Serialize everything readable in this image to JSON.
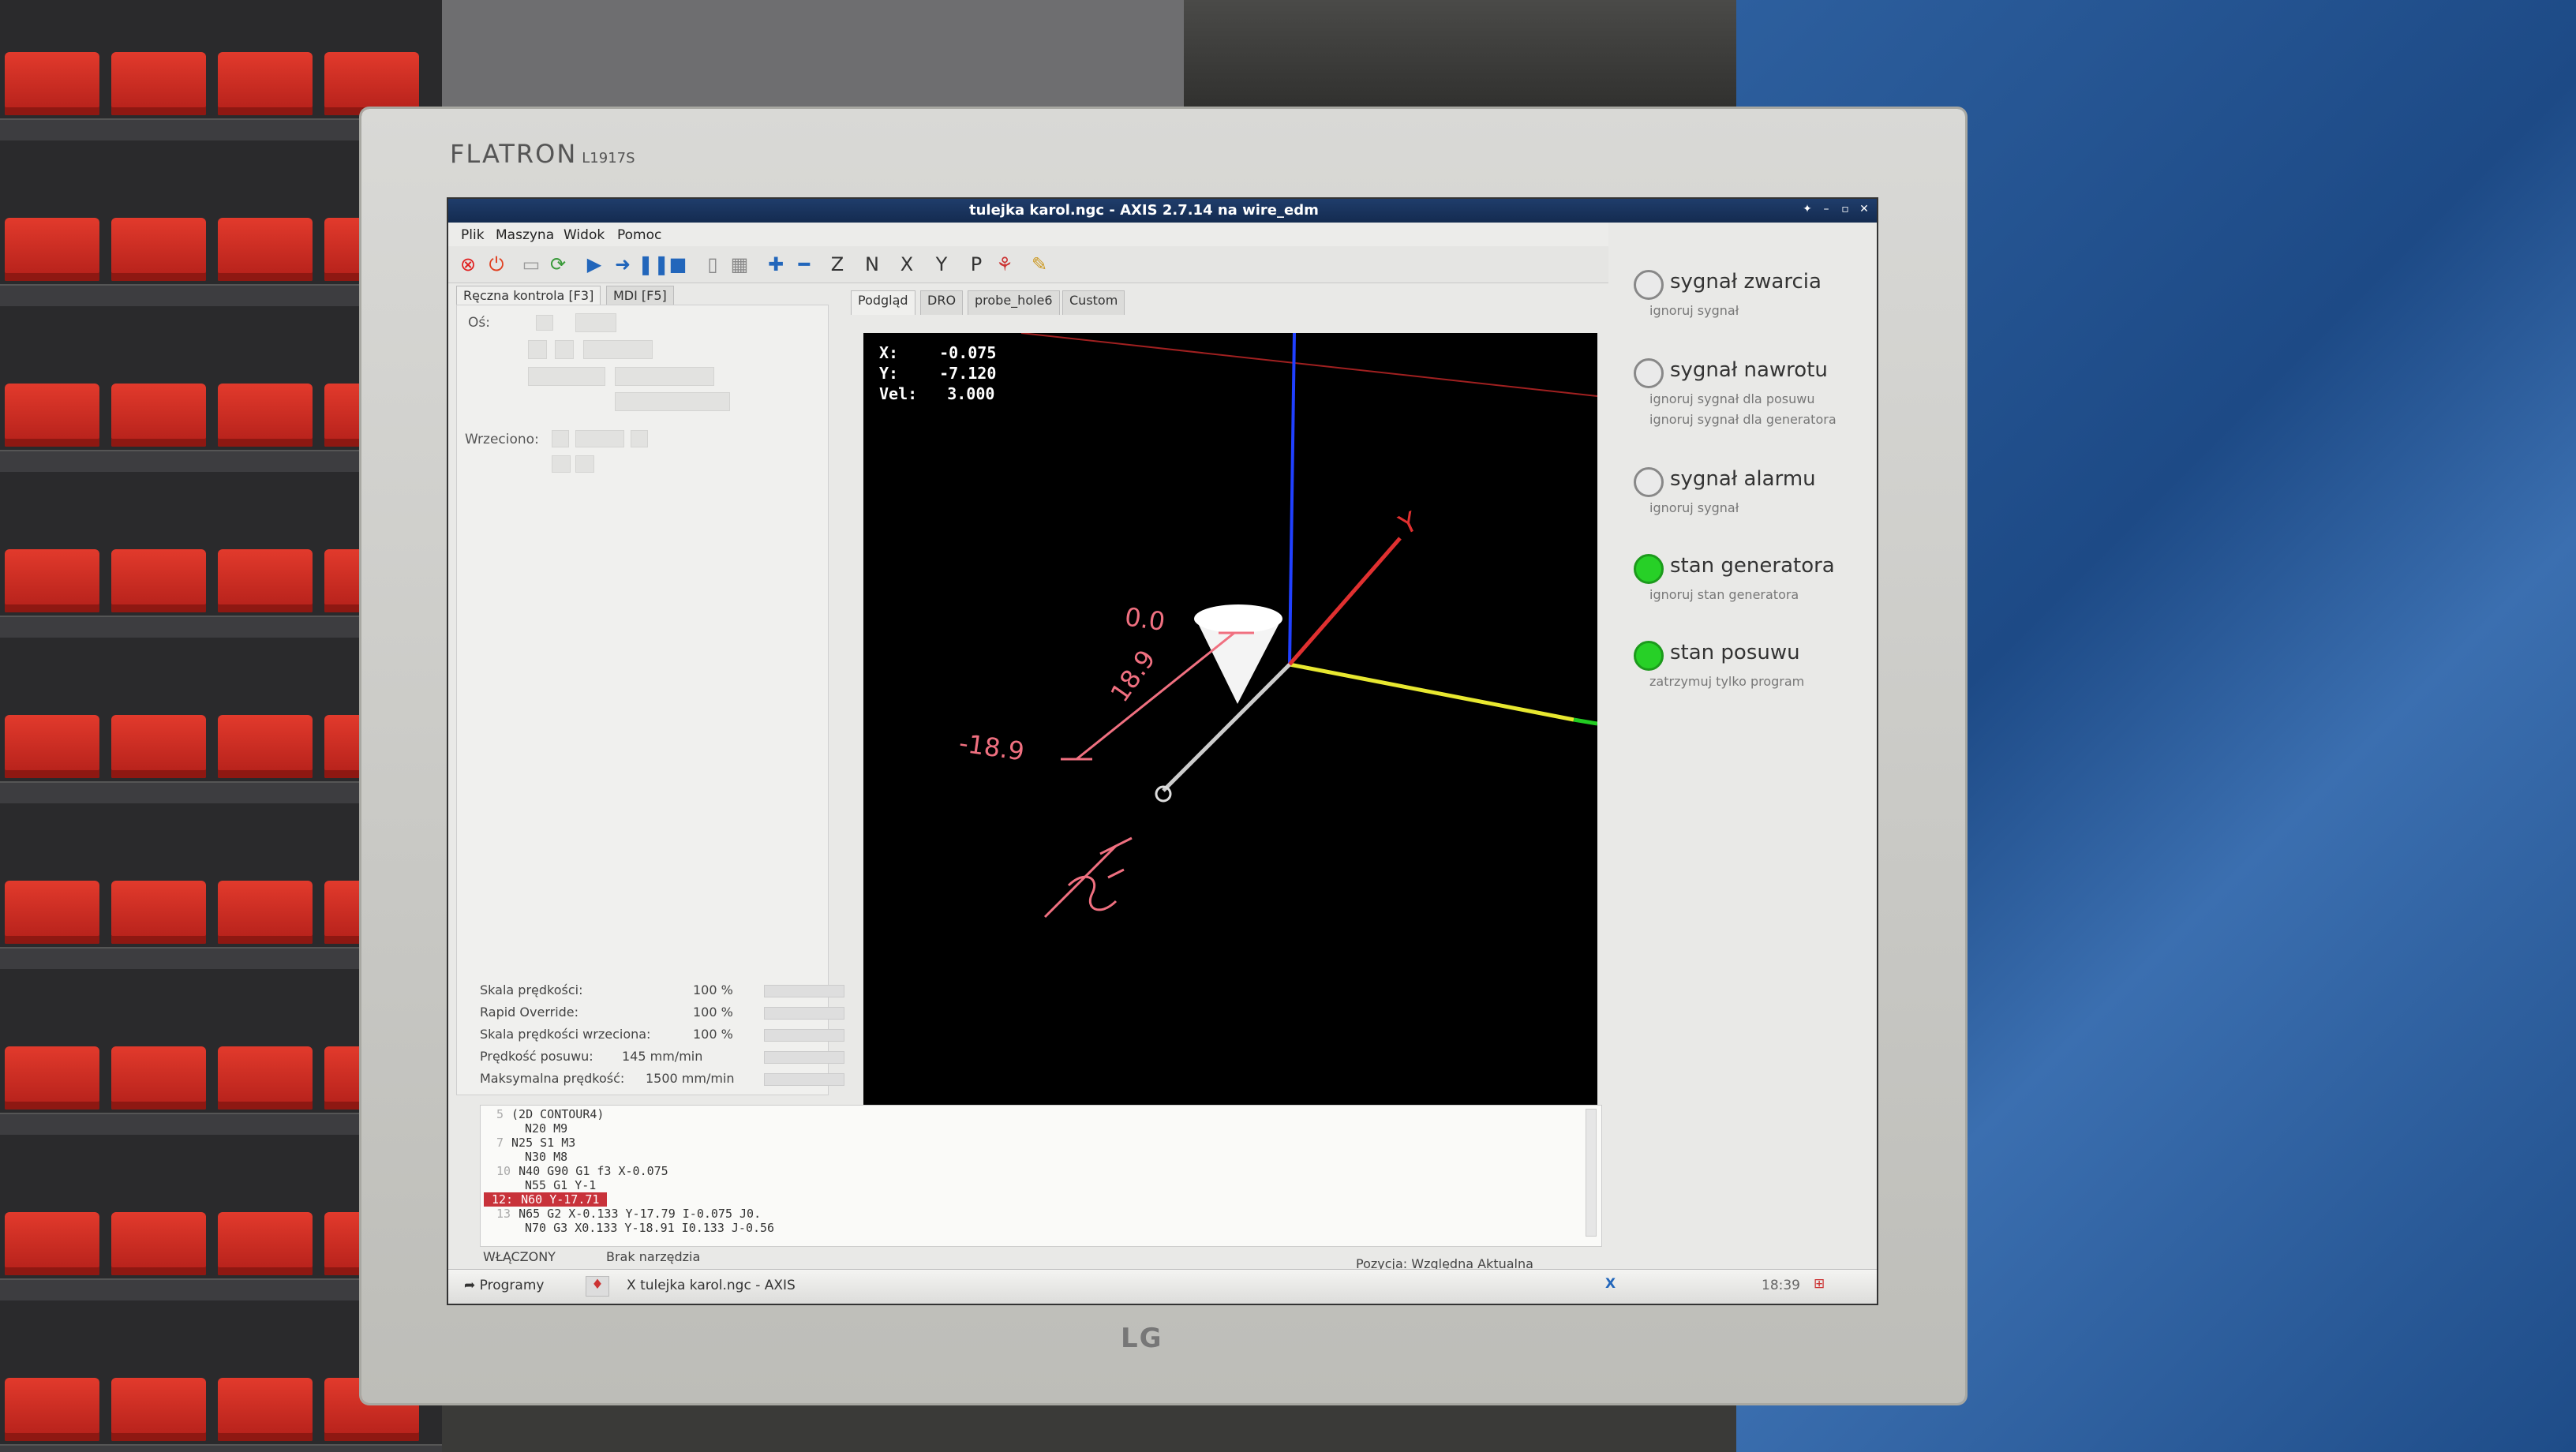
{
  "monitor": {
    "brand": "FLATRON",
    "model": "L1917S",
    "maker": "LG"
  },
  "window": {
    "title": "tulejka karol.ngc - AXIS 2.7.14 na wire_edm"
  },
  "menu": [
    "Plik",
    "Maszyna",
    "Widok",
    "Pomoc"
  ],
  "left_tabs": [
    "Ręczna kontrola [F3]",
    "MDI [F5]"
  ],
  "view_tabs": [
    "Podgląd",
    "DRO",
    "probe_hole6",
    "Custom"
  ],
  "manual": {
    "axis_label": "Oś:",
    "spindle_label": "Wrzeciono:"
  },
  "overrides": [
    {
      "label": "Skala prędkości:",
      "value": "100 %"
    },
    {
      "label": "Rapid Override:",
      "value": "100 %"
    },
    {
      "label": "Skala prędkości wrzeciona:",
      "value": "100 %"
    },
    {
      "label": "Prędkość posuwu:",
      "value": "145 mm/min"
    },
    {
      "label": "Maksymalna prędkość:",
      "value": "1500 mm/min"
    }
  ],
  "dro": {
    "x_label": "X:",
    "x_value": "-0.075",
    "y_label": "Y:",
    "y_value": "-7.120",
    "vel_label": "Vel:",
    "vel_value": "3.000"
  },
  "plot": {
    "labels": [
      "0.0",
      "18.9",
      "-18.9",
      "Y"
    ]
  },
  "gcode": [
    {
      "num": "5",
      "text": "(2D CONTOUR4)"
    },
    {
      "num": "",
      "text": "N20 M9"
    },
    {
      "num": "7",
      "text": "N25 S1 M3"
    },
    {
      "num": "",
      "text": "N30 M8"
    },
    {
      "num": "10",
      "text": "N40 G90 G1 f3 X-0.075"
    },
    {
      "num": "",
      "text": "N55 G1 Y-1"
    },
    {
      "num": "12:",
      "text": "N60 Y-17.71",
      "highlight": true
    },
    {
      "num": "13",
      "text": "N65 G2 X-0.133 Y-17.79 I-0.075 J0."
    },
    {
      "num": "",
      "text": "N70 G3 X0.133 Y-18.91 I0.133 J-0.56"
    }
  ],
  "status": {
    "state": "WŁĄCZONY",
    "tool": "Brak narzędzia",
    "position": "Pozycja: Względna Aktualna"
  },
  "taskbar": {
    "start": "Programy",
    "task": "tulejka karol.ngc - AXIS",
    "clock": "18:39"
  },
  "signals": [
    {
      "name": "sygnał zwarcia",
      "on": false,
      "subs": [
        "ignoruj sygnał"
      ]
    },
    {
      "name": "sygnał nawrotu",
      "on": false,
      "subs": [
        "ignoruj sygnał dla posuwu",
        "ignoruj sygnał dla generatora"
      ]
    },
    {
      "name": "sygnał alarmu",
      "on": false,
      "subs": [
        "ignoruj sygnał"
      ]
    },
    {
      "name": "stan generatora",
      "on": true,
      "subs": [
        "ignoruj stan generatora"
      ]
    },
    {
      "name": "stan posuwu",
      "on": true,
      "subs": [
        "zatrzymuj tylko program"
      ]
    }
  ],
  "colors": {
    "signal_on": "#27d027",
    "highlight_line": "#c8323a",
    "axis_x": "#e03030",
    "axis_y": "#e8e830",
    "axis_z": "#2040ff"
  }
}
